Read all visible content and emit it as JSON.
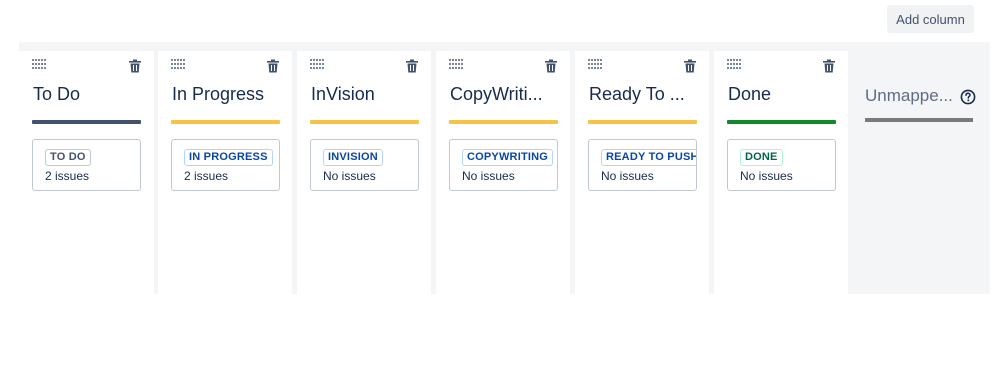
{
  "toolbar": {
    "add_column_label": "Add column"
  },
  "columns": [
    {
      "title": "To Do",
      "bar_color": "#42526e",
      "status": "TO DO",
      "status_style": "grey",
      "count": "2 issues"
    },
    {
      "title": "In Progress",
      "bar_color": "#f6c342",
      "status": "IN PROGRESS",
      "status_style": "blue",
      "count": "2 issues"
    },
    {
      "title": "InVision",
      "bar_color": "#f6c342",
      "status": "INVISION",
      "status_style": "blue",
      "count": "No issues"
    },
    {
      "title": "CopyWriti...",
      "bar_color": "#f6c342",
      "status": "COPYWRITING",
      "status_style": "blue",
      "count": "No issues"
    },
    {
      "title": "Ready To ...",
      "bar_color": "#f6c342",
      "status": "READY TO PUSH",
      "status_style": "blue",
      "count": "No issues"
    },
    {
      "title": "Done",
      "bar_color": "#14892c",
      "status": "DONE",
      "status_style": "green",
      "count": "No issues"
    }
  ],
  "unmapped": {
    "title": "Unmappe...",
    "icon": "help-circle-icon"
  },
  "icons": {
    "drag": "drag-handle-icon",
    "delete": "trash-icon"
  }
}
